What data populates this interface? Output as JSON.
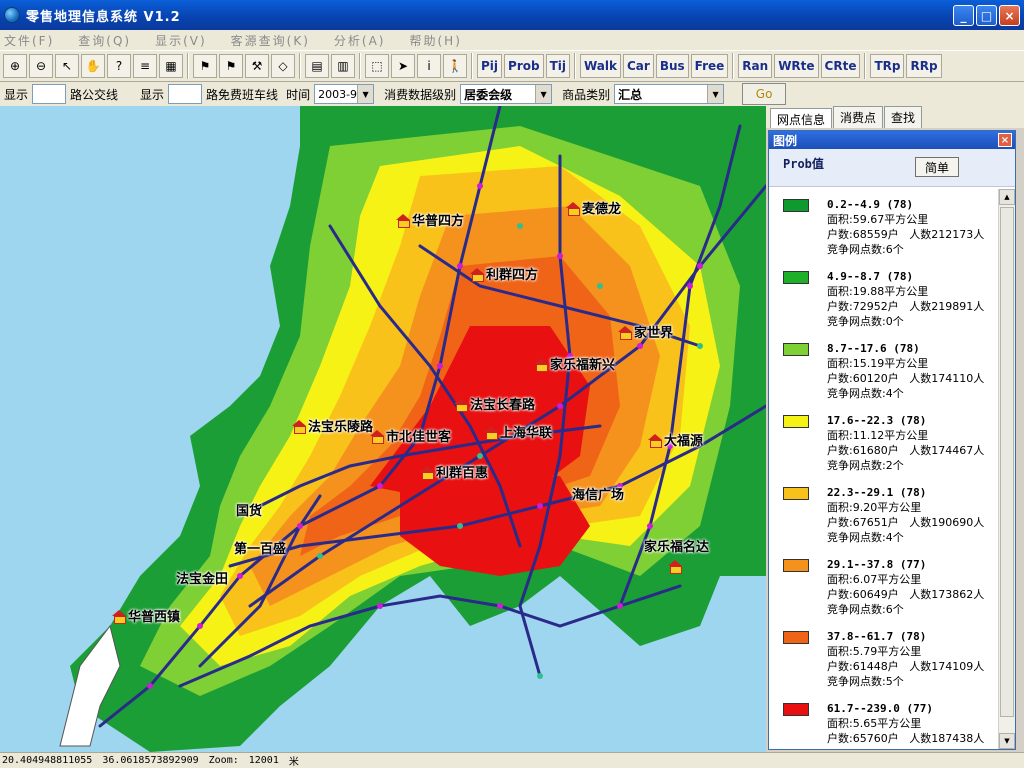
{
  "window": {
    "title": "零售地理信息系统 V1.2",
    "btn_minimize": "_",
    "btn_maximize": "□",
    "btn_close": "×"
  },
  "menu": [
    "文件(F)",
    "查询(Q)",
    "显示(V)",
    "客源查询(K)",
    "分析(A)",
    "帮助(H)"
  ],
  "toolbar_text_buttons": [
    "Pij",
    "Prob",
    "Tij",
    "Walk",
    "Car",
    "Bus",
    "Free",
    "Ran",
    "WRte",
    "CRte",
    "TRp",
    "RRp"
  ],
  "filter": {
    "show_label_1": "显示",
    "bus_route_label": "路公交线",
    "show_label_2": "显示",
    "free_shuttle_label": "路免费班车线",
    "time_label": "时间",
    "time_value": "2003-9",
    "consume_level_label": "消费数据级别",
    "consume_level_value": "居委会级",
    "category_label": "商品类别",
    "category_value": "汇总",
    "go_label": "Go"
  },
  "panel_tabs": [
    "网点信息",
    "消费点",
    "查找"
  ],
  "legend": {
    "title": "图例",
    "metric": "Prob值",
    "simple_button": "简单",
    "items": [
      {
        "range": "0.2--4.9 (78)",
        "color": "#0e9a2e",
        "area": "面积:59.67平方公里",
        "households": "户数:68559户",
        "population": "人数212173人",
        "competitors": "竞争网点数:6个"
      },
      {
        "range": "4.9--8.7 (78)",
        "color": "#1fb02a",
        "area": "面积:19.88平方公里",
        "households": "户数:72952户",
        "population": "人数219891人",
        "competitors": "竞争网点数:0个"
      },
      {
        "range": "8.7--17.6 (78)",
        "color": "#7ed035",
        "area": "面积:15.19平方公里",
        "households": "户数:60120户",
        "population": "人数174110人",
        "competitors": "竞争网点数:4个"
      },
      {
        "range": "17.6--22.3 (78)",
        "color": "#f7f216",
        "area": "面积:11.12平方公里",
        "households": "户数:61680户",
        "population": "人数174467人",
        "competitors": "竞争网点数:2个"
      },
      {
        "range": "22.3--29.1 (78)",
        "color": "#f9c21a",
        "area": "面积:9.20平方公里",
        "households": "户数:67651户",
        "population": "人数190690人",
        "competitors": "竞争网点数:4个"
      },
      {
        "range": "29.1--37.8 (77)",
        "color": "#f5921e",
        "area": "面积:6.07平方公里",
        "households": "户数:60649户",
        "population": "人数173862人",
        "competitors": "竞争网点数:6个"
      },
      {
        "range": "37.8--61.7 (78)",
        "color": "#f06418",
        "area": "面积:5.79平方公里",
        "households": "户数:61448户",
        "population": "人数174109人",
        "competitors": "竞争网点数:5个"
      },
      {
        "range": "61.7--239.0 (77)",
        "color": "#e81010",
        "area": "面积:5.65平方公里",
        "households": "户数:65760户",
        "population": "人数187438人",
        "competitors": ""
      }
    ]
  },
  "map_labels": [
    {
      "name": "华普四方"
    },
    {
      "name": "麦德龙"
    },
    {
      "name": "利群四方"
    },
    {
      "name": "家世界"
    },
    {
      "name": "家乐福新兴"
    },
    {
      "name": "法宝长春路"
    },
    {
      "name": "法宝乐陵路"
    },
    {
      "name": "市北佳世客"
    },
    {
      "name": "上海华联"
    },
    {
      "name": "大福源"
    },
    {
      "name": "利群百惠"
    },
    {
      "name": "海信广场"
    },
    {
      "name": "国货"
    },
    {
      "name": "第一百盛"
    },
    {
      "name": "家乐福名达"
    },
    {
      "name": "法宝金田"
    },
    {
      "name": "华普西镇"
    }
  ],
  "status": {
    "x": "20.404948811055",
    "y": "36.0618573892909",
    "zoom_label": "Zoom:",
    "zoom_value": "12001",
    "unit": "米"
  }
}
